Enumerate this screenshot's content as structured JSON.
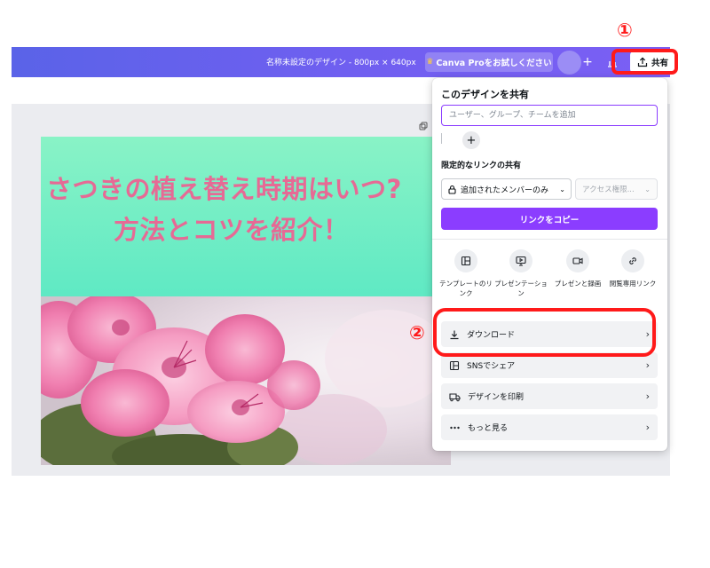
{
  "topbar": {
    "doc_title": "名称未設定のデザイン - 800px × 640px",
    "pro_button": "Canva Proをお試しください",
    "plus": "+",
    "share_button": "共有"
  },
  "design": {
    "headline_line1": "さつきの植え替え時期はいつ?",
    "headline_line2": "方法とコツを紹介！"
  },
  "share_panel": {
    "title": "このデザインを共有",
    "people_placeholder": "ユーザー、グループ、チームを追加",
    "add": "+",
    "restricted_link_label": "限定的なリンクの共有",
    "access_option": "追加されたメンバーのみ",
    "role_option": "アクセス権限...",
    "copy_link_button": "リンクをコピー",
    "options": [
      {
        "label": "テンプレートのリンク",
        "icon": "template-link-icon"
      },
      {
        "label": "プレゼンテーション",
        "icon": "presentation-icon"
      },
      {
        "label": "プレゼンと録画",
        "icon": "record-icon"
      },
      {
        "label": "閲覧専用リンク",
        "icon": "view-link-icon"
      }
    ],
    "rows": [
      {
        "label": "ダウンロード",
        "icon": "download-icon"
      },
      {
        "label": "SNSでシェア",
        "icon": "social-icon"
      },
      {
        "label": "デザインを印刷",
        "icon": "print-icon"
      },
      {
        "label": "もっと見る",
        "icon": "more-icon"
      }
    ]
  },
  "annotations": {
    "step1": "①",
    "step2": "②",
    "color": "#ff1a1a"
  },
  "colors": {
    "accent": "#8b3dff",
    "headline": "#e66a95",
    "banner": "#6cefc5"
  }
}
